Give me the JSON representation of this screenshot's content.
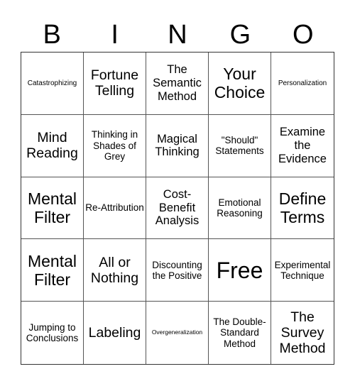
{
  "header": {
    "letters": [
      "B",
      "I",
      "N",
      "G",
      "O"
    ]
  },
  "cells": [
    {
      "text": "Catastrophizing",
      "size": "s-sm"
    },
    {
      "text": "Fortune Telling",
      "size": "s-xl"
    },
    {
      "text": "The Semantic Method",
      "size": "s-lg"
    },
    {
      "text": "Your Choice",
      "size": "s-xxl"
    },
    {
      "text": "Personalization",
      "size": "s-sm"
    },
    {
      "text": "Mind Reading",
      "size": "s-xl"
    },
    {
      "text": "Thinking in Shades of Grey",
      "size": "s-md"
    },
    {
      "text": "Magical Thinking",
      "size": "s-lg"
    },
    {
      "text": "\"Should\" Statements",
      "size": "s-md"
    },
    {
      "text": "Examine the Evidence",
      "size": "s-lg"
    },
    {
      "text": "Mental Filter",
      "size": "s-xxl"
    },
    {
      "text": "Re-Attribution",
      "size": "s-md"
    },
    {
      "text": "Cost-Benefit Analysis",
      "size": "s-lg"
    },
    {
      "text": "Emotional Reasoning",
      "size": "s-md"
    },
    {
      "text": "Define Terms",
      "size": "s-xxl"
    },
    {
      "text": "Mental Filter",
      "size": "s-xxl"
    },
    {
      "text": "All or Nothing",
      "size": "s-xl"
    },
    {
      "text": "Discounting the Positive",
      "size": "s-md"
    },
    {
      "text": "Free",
      "size": "s-free"
    },
    {
      "text": "Experimental Technique",
      "size": "s-md"
    },
    {
      "text": "Jumping to Conclusions",
      "size": "s-md"
    },
    {
      "text": "Labeling",
      "size": "s-xl"
    },
    {
      "text": "Overgeneralization",
      "size": "s-xs"
    },
    {
      "text": "The Double-Standard Method",
      "size": "s-md"
    },
    {
      "text": "The Survey Method",
      "size": "s-xl"
    }
  ]
}
